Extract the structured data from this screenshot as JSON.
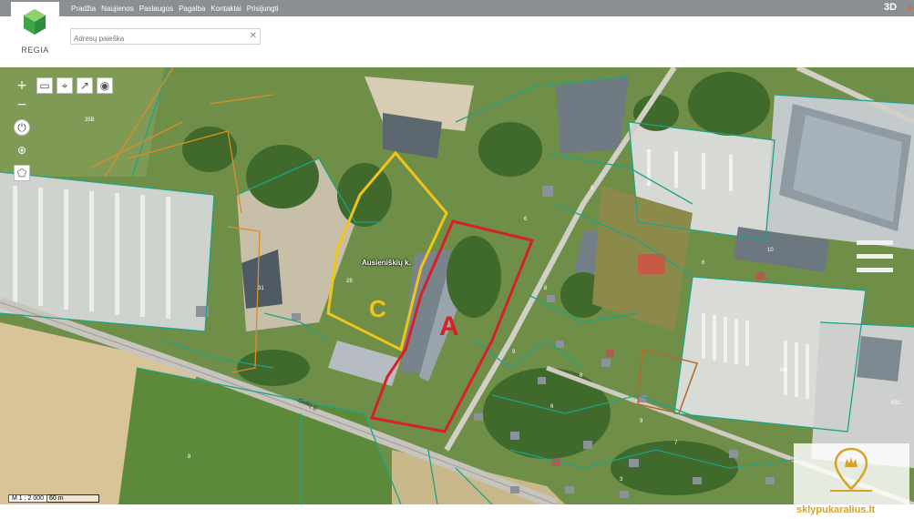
{
  "header": {
    "nav": [
      "Pradžia",
      "Naujienos",
      "Paslaugos",
      "Pagalba",
      "Kontaktai",
      "Prisijungti"
    ],
    "btn_3d": "3D",
    "btn_side": "SV"
  },
  "logo": {
    "name": "REGIA"
  },
  "search": {
    "placeholder": "Adresų paieška",
    "value": ""
  },
  "map": {
    "street_label": "Ausieniškių k.",
    "road_label": "Gelių g.",
    "zone_a": "A",
    "zone_c": "C",
    "zone_a_color": "#d8202b",
    "zone_c_color": "#f0c419",
    "parcel_line_color": "#1fa386",
    "parcel_numbers": [
      "35B",
      "28",
      "31",
      "10",
      "6",
      "6",
      "6B",
      "63C",
      "8",
      "9",
      "8",
      "6",
      "5",
      "7",
      "9",
      "3",
      "8"
    ]
  },
  "scale": {
    "ratio": "M 1 : 2 000",
    "distance": "60 m"
  },
  "watermark": {
    "text": "sklypukaralius.lt"
  }
}
